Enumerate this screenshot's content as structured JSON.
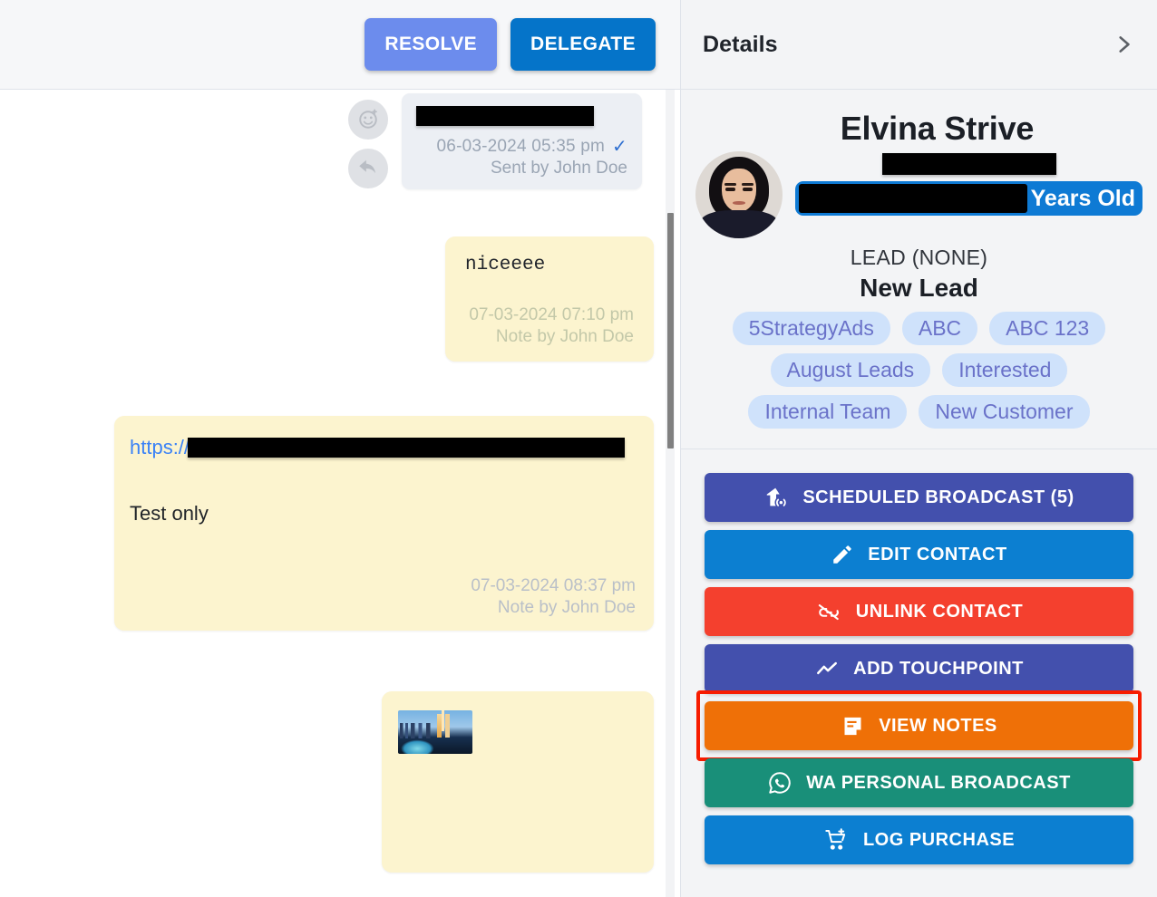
{
  "toolbar": {
    "resolve_label": "RESOLVE",
    "delegate_label": "DELEGATE"
  },
  "conversation": {
    "messages": [
      {
        "kind": "outgoing",
        "body_redacted": true,
        "timestamp": "06-03-2024 05:35 pm",
        "status_icon": "check-icon",
        "author_line": "Sent by John Doe"
      },
      {
        "kind": "note",
        "text": "niceeee",
        "timestamp": "07-03-2024 07:10 pm",
        "author_line": "Note by John Doe"
      },
      {
        "kind": "note",
        "link_prefix": "https://",
        "link_redacted": true,
        "text": "Test only",
        "timestamp": "07-03-2024 08:37 pm",
        "author_line": "Note by John Doe"
      },
      {
        "kind": "note",
        "attachment": "city-skyline-thumbnail"
      }
    ]
  },
  "details": {
    "title": "Details",
    "collapse_icon": "chevron-right-icon",
    "contact": {
      "name": "Elvina Strive",
      "avatar": "contact-photo",
      "phone_redacted": true,
      "age_redacted": true,
      "age_suffix": "Years Old",
      "lead_label": "LEAD (NONE)",
      "lead_status": "New Lead",
      "tags": [
        "5StrategyAds",
        "ABC",
        "ABC 123",
        "August Leads",
        "Interested",
        "Internal Team",
        "New Customer"
      ]
    },
    "actions": [
      {
        "label": "SCHEDULED BROADCAST (5)",
        "icon": "broadcast-icon",
        "color": "#4350ad",
        "highlighted": false
      },
      {
        "label": "EDIT CONTACT",
        "icon": "pencil-icon",
        "color": "#0c7fd1",
        "highlighted": false
      },
      {
        "label": "UNLINK CONTACT",
        "icon": "broken-link-icon",
        "color": "#f4402e",
        "highlighted": false
      },
      {
        "label": "ADD TOUCHPOINT",
        "icon": "trend-line-icon",
        "color": "#4350ad",
        "highlighted": false
      },
      {
        "label": "VIEW NOTES",
        "icon": "note-icon",
        "color": "#ef7007",
        "highlighted": true
      },
      {
        "label": "WA PERSONAL BROADCAST",
        "icon": "whatsapp-icon",
        "color": "#198f79",
        "highlighted": false
      },
      {
        "label": "LOG PURCHASE",
        "icon": "add-cart-icon",
        "color": "#0c7fd1",
        "highlighted": false
      }
    ]
  },
  "colors": {
    "resolve": "#6c8ced",
    "delegate": "#0574c9",
    "note_bubble": "#fcf4cf",
    "message_bubble": "#eceff4",
    "tag_bg": "#cfe2fb",
    "tag_text": "#6a72c9",
    "highlight_border": "#f71c00",
    "age_badge": "#0e7ad4"
  }
}
